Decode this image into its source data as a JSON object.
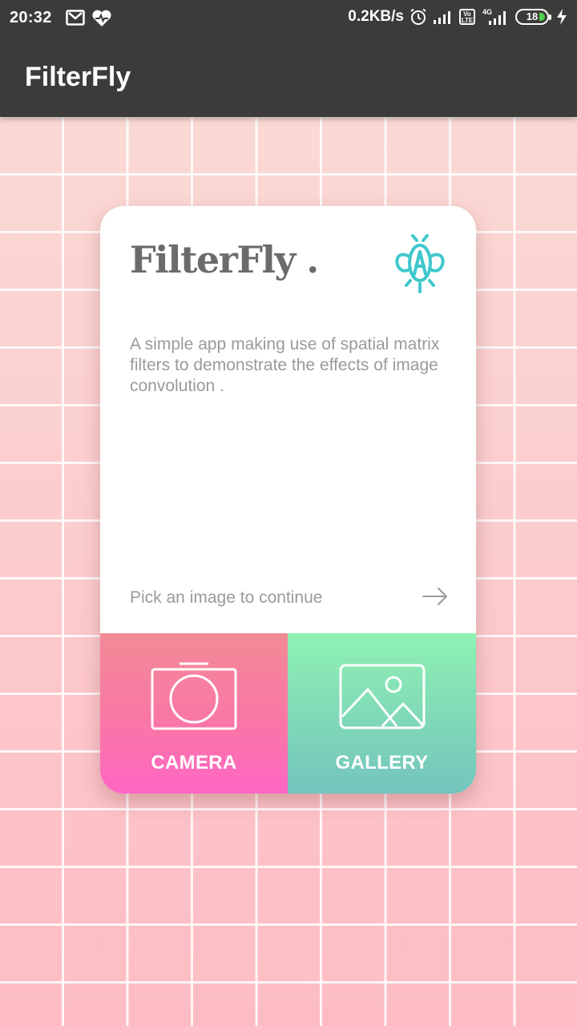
{
  "status_bar": {
    "time": "20:32",
    "net_speed": "0.2KB/s",
    "volte": "Vo LTE",
    "network_type": "4G",
    "battery_level": "18",
    "icons": [
      "gmail-icon",
      "health-icon",
      "alarm-icon",
      "signal-icon",
      "volte-icon",
      "signal-4g-icon",
      "battery-icon",
      "charging-icon"
    ]
  },
  "app_bar": {
    "title": "FilterFly"
  },
  "card": {
    "brand": "FilterFly .",
    "brand_icon": "firefly-icon",
    "accent_color": "#3fc8cc",
    "description": "A simple app making use of spatial matrix filters to demonstrate the effects of image convolution .",
    "pick_prompt": "Pick an image to continue",
    "pick_icon": "arrow-right-icon"
  },
  "actions": {
    "camera": {
      "label": "CAMERA",
      "icon": "camera-icon",
      "color": "#ff66c4"
    },
    "gallery": {
      "label": "GALLERY",
      "icon": "image-icon",
      "color": "#8ff2b2"
    }
  }
}
